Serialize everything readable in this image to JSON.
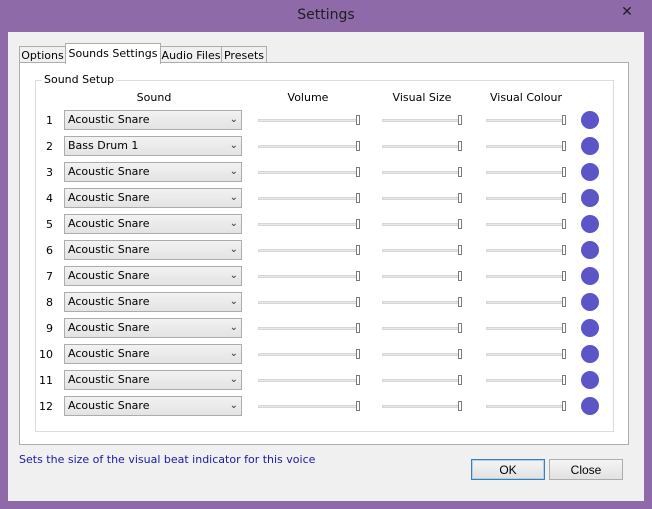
{
  "window": {
    "title": "Settings",
    "close_glyph": "✕"
  },
  "tabs": [
    "Options",
    "Sounds Settings",
    "Audio Files",
    "Presets"
  ],
  "active_tab": "Sounds Settings",
  "group": {
    "label": "Sound Setup"
  },
  "columns": {
    "sound": "Sound",
    "volume": "Volume",
    "visual_size": "Visual Size",
    "visual_colour": "Visual Colour"
  },
  "rows": [
    {
      "num": "1",
      "sound": "Acoustic Snare",
      "volume": 1.0,
      "visual_size": 1.0,
      "colour": "#5b55c8"
    },
    {
      "num": "2",
      "sound": "Bass Drum 1",
      "volume": 1.0,
      "visual_size": 1.0,
      "colour": "#5b55c8"
    },
    {
      "num": "3",
      "sound": "Acoustic Snare",
      "volume": 1.0,
      "visual_size": 1.0,
      "colour": "#5b55c8"
    },
    {
      "num": "4",
      "sound": "Acoustic Snare",
      "volume": 1.0,
      "visual_size": 1.0,
      "colour": "#5b55c8"
    },
    {
      "num": "5",
      "sound": "Acoustic Snare",
      "volume": 1.0,
      "visual_size": 1.0,
      "colour": "#5b55c8"
    },
    {
      "num": "6",
      "sound": "Acoustic Snare",
      "volume": 1.0,
      "visual_size": 1.0,
      "colour": "#5b55c8"
    },
    {
      "num": "7",
      "sound": "Acoustic Snare",
      "volume": 1.0,
      "visual_size": 1.0,
      "colour": "#5b55c8"
    },
    {
      "num": "8",
      "sound": "Acoustic Snare",
      "volume": 1.0,
      "visual_size": 1.0,
      "colour": "#5b55c8"
    },
    {
      "num": "9",
      "sound": "Acoustic Snare",
      "volume": 1.0,
      "visual_size": 1.0,
      "colour": "#5b55c8"
    },
    {
      "num": "10",
      "sound": "Acoustic Snare",
      "volume": 1.0,
      "visual_size": 1.0,
      "colour": "#5b55c8"
    },
    {
      "num": "11",
      "sound": "Acoustic Snare",
      "volume": 1.0,
      "visual_size": 1.0,
      "colour": "#5b55c8"
    },
    {
      "num": "12",
      "sound": "Acoustic Snare",
      "volume": 1.0,
      "visual_size": 1.0,
      "colour": "#5b55c8"
    }
  ],
  "status_text": "Sets the size of the visual beat indicator for this voice",
  "buttons": {
    "ok": "OK",
    "close": "Close"
  }
}
